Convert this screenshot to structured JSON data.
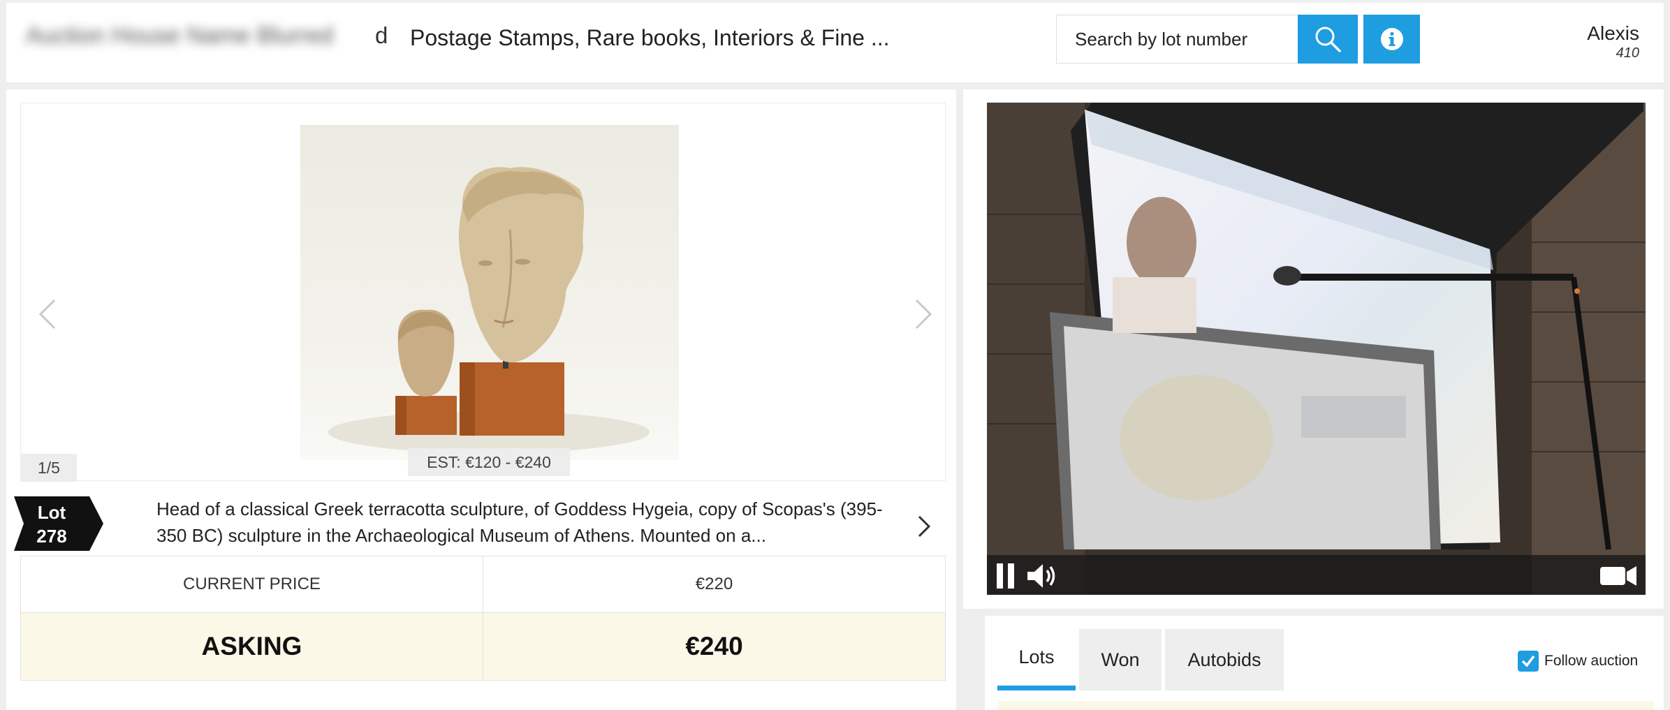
{
  "header": {
    "auction_name_tail": "d",
    "auction_title": "Postage Stamps, Rare books, Interiors & Fine ...",
    "search_placeholder": "Search by lot number",
    "search_icon": "search-icon",
    "info_icon": "info-icon",
    "user_name": "Alexis",
    "user_number": "410"
  },
  "lot": {
    "image_counter": "1/5",
    "estimate": "EST: €120 - €240",
    "badge_label": "Lot",
    "badge_number": "278",
    "description": "Head of a classical Greek terracotta sculpture, of Goddess Hygeia, copy of Scopas's (395-350 BC) sculpture in the Archaeological Museum of Athens. Mounted on a..."
  },
  "price": {
    "current_label": "CURRENT PRICE",
    "current_value": "€220",
    "asking_label": "ASKING",
    "asking_value": "€240"
  },
  "video": {
    "controls": [
      "pause-icon",
      "volume-icon",
      "camera-icon"
    ]
  },
  "tabs": [
    {
      "label": "Lots",
      "active": true
    },
    {
      "label": "Won",
      "active": false
    },
    {
      "label": "Autobids",
      "active": false
    }
  ],
  "follow_auction": {
    "label": "Follow auction",
    "checked": true
  },
  "colors": {
    "accent": "#1e9de0",
    "asking_bg": "#fcf8e8"
  }
}
